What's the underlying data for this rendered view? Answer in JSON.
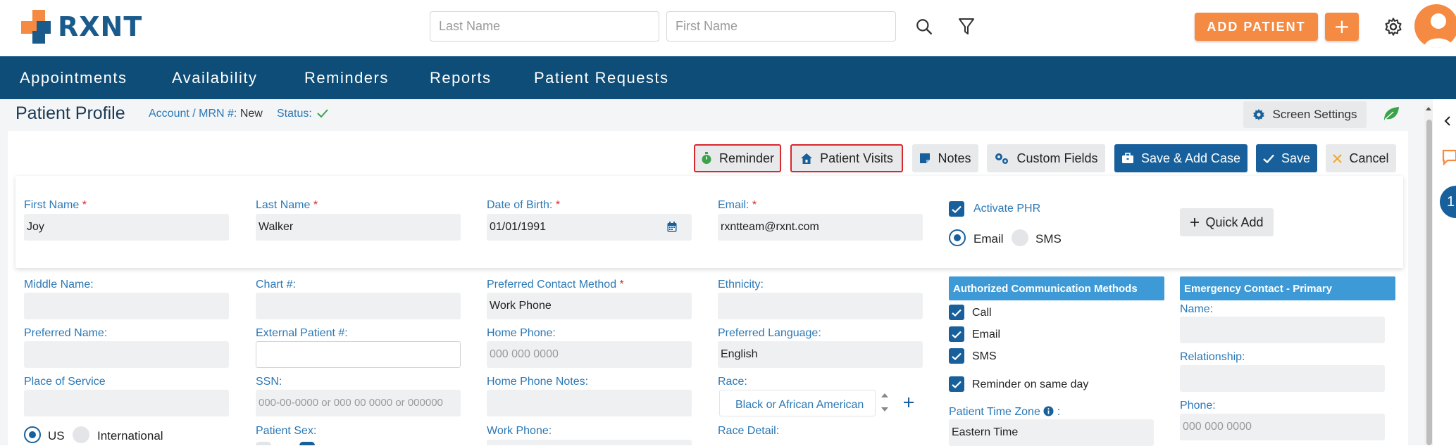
{
  "app": {
    "brand": "RXNT"
  },
  "search": {
    "last_name_placeholder": "Last Name",
    "first_name_placeholder": "First Name"
  },
  "header": {
    "add_patient_label": "ADD PATIENT",
    "add_plus_label": "+"
  },
  "nav": {
    "items": [
      "Appointments",
      "Availability",
      "Reminders",
      "Reports",
      "Patient Requests"
    ]
  },
  "page": {
    "title": "Patient Profile",
    "account_label": "Account / MRN #:",
    "account_value": "New",
    "status_label": "Status:",
    "screen_settings_label": "Screen Settings"
  },
  "toolbar": {
    "reminder": "Reminder",
    "patient_visits": "Patient Visits",
    "notes": "Notes",
    "custom_fields": "Custom Fields",
    "save_add_case": "Save & Add Case",
    "save": "Save",
    "cancel": "Cancel"
  },
  "form": {
    "first_name": {
      "label": "First Name",
      "value": "Joy"
    },
    "last_name": {
      "label": "Last Name",
      "value": "Walker"
    },
    "dob": {
      "label": "Date of Birth:",
      "value": "01/01/1991"
    },
    "email": {
      "label": "Email:",
      "value": "rxntteam@rxnt.com"
    },
    "activate_phr": "Activate PHR",
    "phr_email": "Email",
    "phr_sms": "SMS",
    "quick_add": "Quick Add",
    "middle_name": {
      "label": "Middle Name:",
      "value": ""
    },
    "chart": {
      "label": "Chart #:",
      "value": ""
    },
    "preferred_contact": {
      "label": "Preferred Contact Method",
      "value": "Work Phone"
    },
    "ethnicity": {
      "label": "Ethnicity:",
      "value": ""
    },
    "preferred_name": {
      "label": "Preferred Name:",
      "value": ""
    },
    "external_patient": {
      "label": "External Patient #:",
      "value": ""
    },
    "home_phone": {
      "label": "Home Phone:",
      "placeholder": "000 000 0000"
    },
    "preferred_language": {
      "label": "Preferred Language:",
      "value": "English"
    },
    "place_of_service": {
      "label": "Place of Service",
      "value": ""
    },
    "ssn": {
      "label": "SSN:",
      "placeholder": "000-00-0000 or 000 00 0000 or 000000"
    },
    "home_phone_notes": {
      "label": "Home Phone Notes:",
      "value": ""
    },
    "race": {
      "label": "Race:",
      "value": "Black or African American"
    },
    "us_label": "US",
    "international_label": "International",
    "patient_sex": {
      "label": "Patient Sex:"
    },
    "work_phone": {
      "label": "Work Phone:"
    },
    "race_detail": {
      "label": "Race Detail:"
    },
    "auth_comm": {
      "title": "Authorized Communication Methods",
      "items": [
        "Call",
        "Email",
        "SMS"
      ],
      "reminder_same_day": "Reminder on same day"
    },
    "time_zone": {
      "label": "Patient Time Zone",
      "value": "Eastern Time"
    },
    "emergency": {
      "title": "Emergency Contact - Primary",
      "name_label": "Name:",
      "relationship_label": "Relationship:",
      "phone_label": "Phone:",
      "phone_placeholder": "000 000 0000"
    }
  },
  "side": {
    "badge": "1"
  },
  "colors": {
    "brand_blue": "#0e4d77",
    "accent_orange": "#f58a42",
    "button_blue": "#17609b",
    "label_blue": "#2b78b6",
    "required_red": "#d9272e"
  }
}
